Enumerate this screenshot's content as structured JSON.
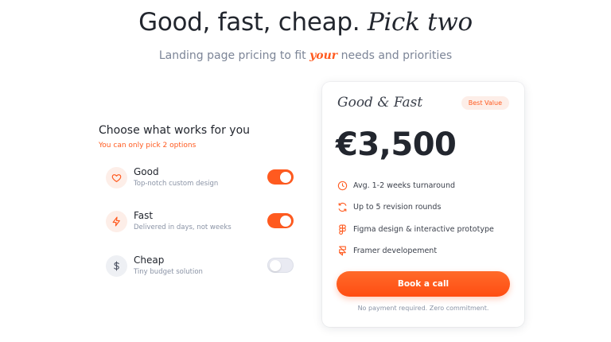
{
  "hero": {
    "title_main": "Good, fast, cheap.",
    "title_accent": "Pick two",
    "subtitle_before": "Landing page pricing to fit ",
    "subtitle_em": "your",
    "subtitle_after": " needs and priorities"
  },
  "chooser": {
    "title": "Choose what works for you",
    "subtitle": "You can only pick 2 options",
    "options": [
      {
        "label": "Good",
        "description": "Top-notch custom design",
        "icon": "heart-icon",
        "enabled": true
      },
      {
        "label": "Fast",
        "description": "Delivered in days, not weeks",
        "icon": "lightning-icon",
        "enabled": true
      },
      {
        "label": "Cheap",
        "description": "Tiny budget solution",
        "icon": "dollar-icon",
        "enabled": false
      }
    ]
  },
  "card": {
    "title": "Good & Fast",
    "badge": "Best Value",
    "price": "€3,500",
    "features": [
      {
        "text": "Avg. 1-2 weeks turnaround",
        "icon": "clock-icon"
      },
      {
        "text": "Up to 5 revision rounds",
        "icon": "refresh-icon"
      },
      {
        "text": "Figma design & interactive prototype",
        "icon": "figma-icon"
      },
      {
        "text": "Framer developement",
        "icon": "framer-icon"
      }
    ],
    "cta_label": "Book a call",
    "note": "No payment required. Zero commitment."
  },
  "colors": {
    "accent": "#ff5a1f",
    "accent_soft": "#fdeee8",
    "text": "#22262e",
    "muted": "#8a93a5",
    "toggle_off": "#e9eaf2"
  }
}
